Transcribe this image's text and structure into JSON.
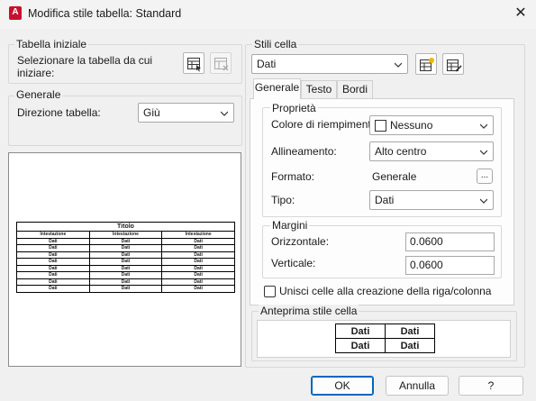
{
  "window": {
    "title": "Modifica stile tabella: Standard",
    "app_icon_letter": "A"
  },
  "left": {
    "initial_table": {
      "title": "Tabella iniziale",
      "prompt": "Selezionare la tabella da cui iniziare:"
    },
    "general": {
      "title": "Generale",
      "direction_label": "Direzione tabella:",
      "direction_value": "Giù"
    },
    "preview": {
      "title": "Titolo",
      "headers": [
        "Intestazione",
        "Intestazione",
        "Intestazione"
      ],
      "rows": [
        [
          "Dati",
          "Dati",
          "Dati"
        ],
        [
          "Dati",
          "Dati",
          "Dati"
        ],
        [
          "Dati",
          "Dati",
          "Dati"
        ],
        [
          "Dati",
          "Dati",
          "Dati"
        ],
        [
          "Dati",
          "Dati",
          "Dati"
        ],
        [
          "Dati",
          "Dati",
          "Dati"
        ],
        [
          "Dati",
          "Dati",
          "Dati"
        ],
        [
          "Dati",
          "Dati",
          "Dati"
        ]
      ]
    }
  },
  "right": {
    "cell_styles": {
      "title": "Stili cella",
      "value": "Dati"
    },
    "tabs": [
      "Generale",
      "Testo",
      "Bordi"
    ],
    "properties": {
      "title": "Proprietà",
      "fill_label": "Colore di riempimento:",
      "fill_value": "Nessuno",
      "align_label": "Allineamento:",
      "align_value": "Alto centro",
      "format_label": "Formato:",
      "format_value": "Generale",
      "format_button": "...",
      "type_label": "Tipo:",
      "type_value": "Dati"
    },
    "margins": {
      "title": "Margini",
      "horizontal_label": "Orizzontale:",
      "horizontal_value": "0.0600",
      "vertical_label": "Verticale:",
      "vertical_value": "0.0600"
    },
    "merge_label": "Unisci celle alla creazione della riga/colonna",
    "cell_preview": {
      "title": "Anteprima stile cella",
      "cells": [
        [
          "Dati",
          "Dati"
        ],
        [
          "Dati",
          "Dati"
        ]
      ]
    }
  },
  "buttons": {
    "ok": "OK",
    "cancel": "Annulla",
    "help": "?"
  },
  "colors": {
    "accent": "#0067c0",
    "app_icon": "#c8102e"
  }
}
